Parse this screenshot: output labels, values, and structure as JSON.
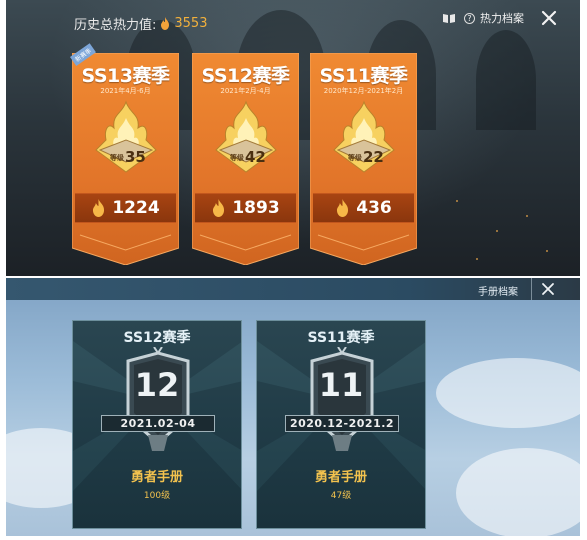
{
  "top": {
    "total_label": "历史总热力值:",
    "total_value": "3553",
    "archive_label": "热力档案",
    "help_glyph": "?",
    "new_badge": "新赛季",
    "seasons": [
      {
        "title": "SS13赛季",
        "dates": "2021年4月-6月",
        "rank_label": "等级",
        "rank": "35",
        "heat": "1224"
      },
      {
        "title": "SS12赛季",
        "dates": "2021年2月-4月",
        "rank_label": "等级",
        "rank": "42",
        "heat": "1893"
      },
      {
        "title": "SS11赛季",
        "dates": "2020年12月-2021年2月",
        "rank_label": "等级",
        "rank": "22",
        "heat": "436"
      }
    ]
  },
  "bottom": {
    "header_label": "手册档案",
    "passes": [
      {
        "title": "SS12赛季",
        "level": "12",
        "date": "2021.02-04",
        "name": "勇者手册",
        "grade": "100级"
      },
      {
        "title": "SS11赛季",
        "level": "11",
        "date": "2020.12-2021.2",
        "name": "勇者手册",
        "grade": "47级"
      }
    ]
  },
  "colors": {
    "accent_orange": "#e07a2a",
    "gold": "#f2c24e",
    "heat_value": "#f2b03c"
  },
  "icons": [
    "flame-icon",
    "book-icon",
    "help-icon",
    "close-icon",
    "rank-emblem-icon",
    "pass-emblem-icon"
  ]
}
